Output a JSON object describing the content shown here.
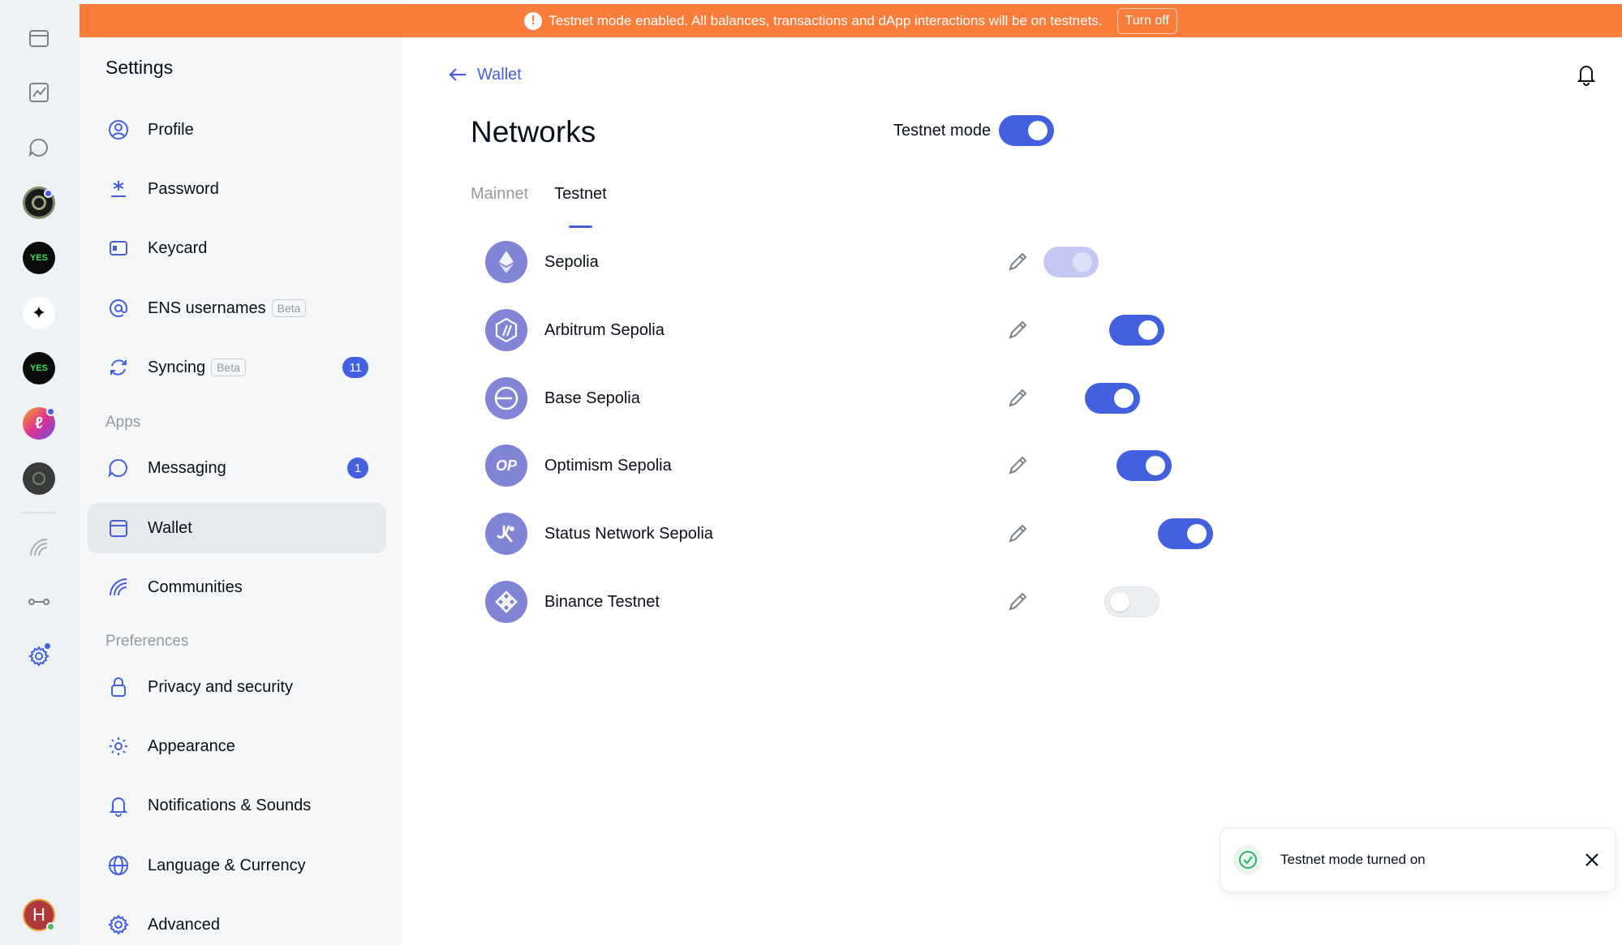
{
  "banner": {
    "icon": "alert-icon",
    "text": "Testnet mode enabled. All balances, transactions and dApp interactions will be on testnets.",
    "button": "Turn off",
    "color": "#fa7d3c"
  },
  "rail": {
    "avatar_initial": "H",
    "community_1": "YES",
    "community_2": "YES"
  },
  "settings": {
    "title": "Settings",
    "items": [
      {
        "label": "Profile",
        "icon": "profile-icon"
      },
      {
        "label": "Password",
        "icon": "password-icon"
      },
      {
        "label": "Keycard",
        "icon": "keycard-icon"
      },
      {
        "label": "ENS usernames",
        "icon": "at-icon",
        "badge": "Beta"
      },
      {
        "label": "Syncing",
        "icon": "sync-icon",
        "badge": "Beta",
        "count": "11"
      }
    ],
    "apps_label": "Apps",
    "apps": [
      {
        "label": "Messaging",
        "icon": "chat-icon",
        "count": "1"
      },
      {
        "label": "Wallet",
        "icon": "wallet-icon"
      },
      {
        "label": "Communities",
        "icon": "communities-icon"
      }
    ],
    "preferences_label": "Preferences",
    "preferences": [
      {
        "label": "Privacy and security",
        "icon": "lock-icon"
      },
      {
        "label": "Appearance",
        "icon": "sun-icon"
      },
      {
        "label": "Notifications & Sounds",
        "icon": "bell-icon"
      },
      {
        "label": "Language & Currency",
        "icon": "globe-icon"
      },
      {
        "label": "Advanced",
        "icon": "gear-icon"
      }
    ]
  },
  "main": {
    "back_label": "Wallet",
    "title": "Networks",
    "testnet_mode_label": "Testnet mode",
    "testnet_mode_on": true,
    "tabs": [
      "Mainnet",
      "Testnet"
    ],
    "active_tab": "Testnet",
    "networks": [
      {
        "name": "Sepolia",
        "icon": "ethereum-icon",
        "state": "disabled-on"
      },
      {
        "name": "Arbitrum Sepolia",
        "icon": "arbitrum-icon",
        "state": "on"
      },
      {
        "name": "Base Sepolia",
        "icon": "base-icon",
        "state": "on"
      },
      {
        "name": "Optimism Sepolia",
        "icon": "optimism-icon",
        "icon_text": "OP",
        "state": "on"
      },
      {
        "name": "Status Network Sepolia",
        "icon": "status-icon",
        "state": "on"
      },
      {
        "name": "Binance Testnet",
        "icon": "binance-icon",
        "state": "off"
      }
    ]
  },
  "toast": {
    "text": "Testnet mode turned on",
    "icon": "check-circle-icon"
  },
  "colors": {
    "accent": "#4360df",
    "network_icon_bg": "#8085d6",
    "success": "#26a69a"
  }
}
